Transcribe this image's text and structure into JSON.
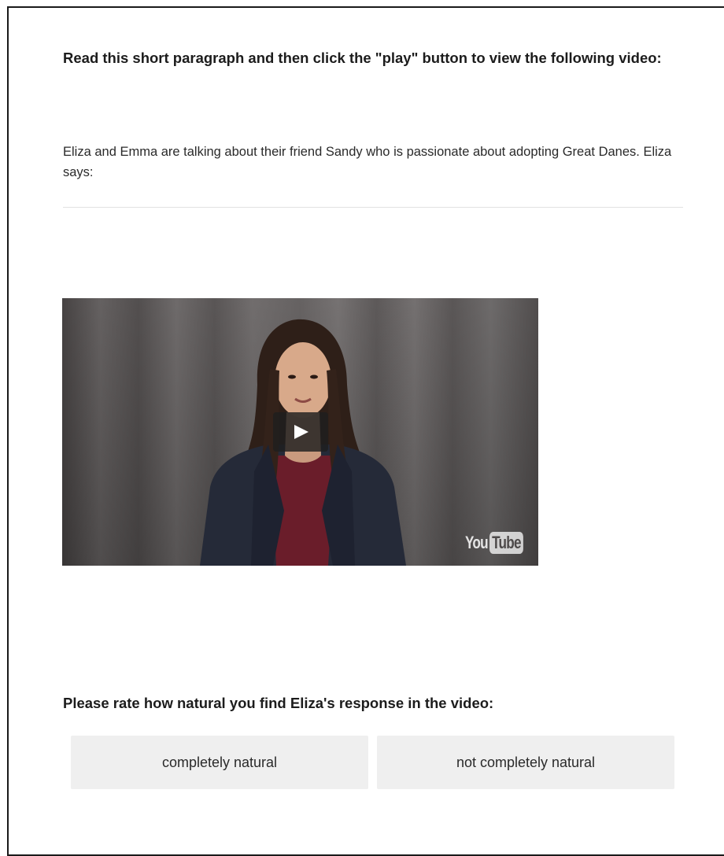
{
  "instruction": "Read this short paragraph and then click the \"play\" button to view the following video:",
  "context": "Eliza and Emma are talking about their friend Sandy who is passionate about adopting Great Danes. Eliza says:",
  "video": {
    "logo_you": "You",
    "logo_tube": "Tube",
    "play_icon": "play-icon"
  },
  "question": "Please rate how natural you find Eliza's response in the video:",
  "choices": [
    {
      "label": "completely natural"
    },
    {
      "label": "not completely natural"
    }
  ],
  "colors": {
    "choice_bg": "#efefef",
    "frame_border": "#1a1a1a",
    "divider": "#e2e2e2"
  }
}
